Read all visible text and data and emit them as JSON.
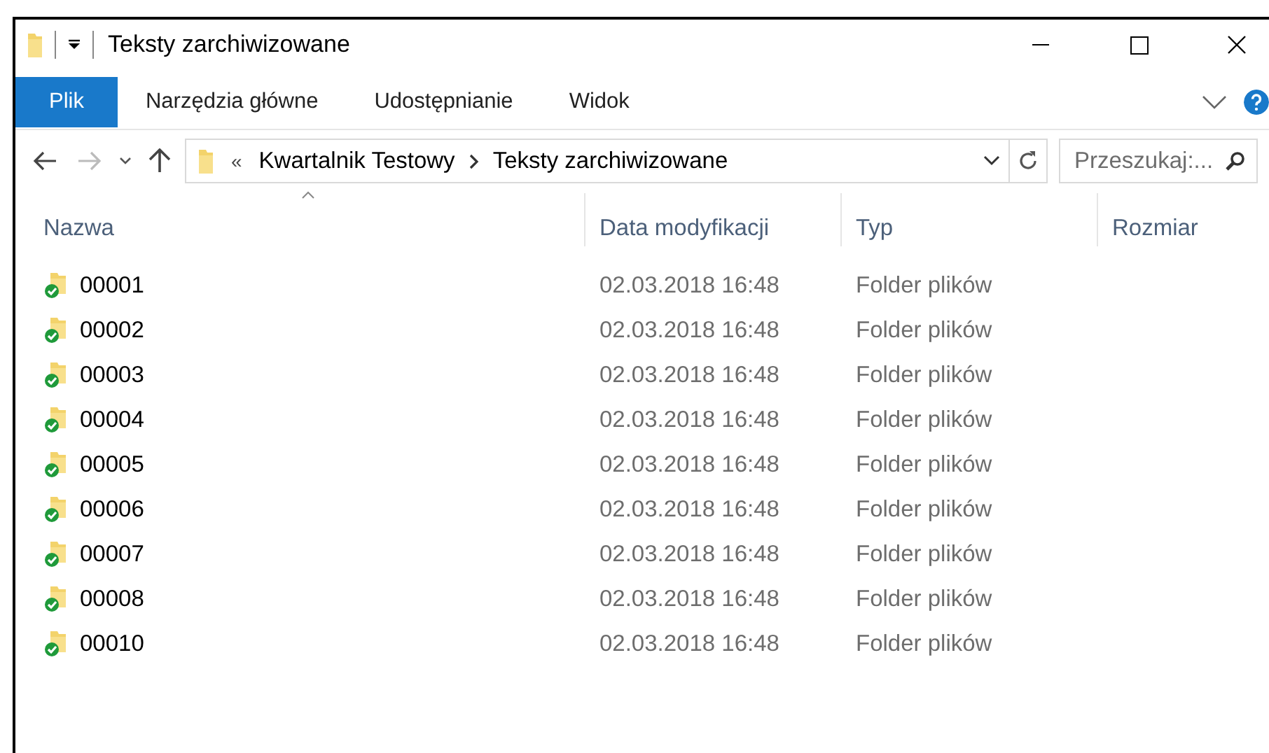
{
  "window": {
    "title": "Teksty zarchiwizowane"
  },
  "ribbon": {
    "tabs": [
      {
        "label": "Plik",
        "selected": true
      },
      {
        "label": "Narzędzia główne",
        "selected": false
      },
      {
        "label": "Udostępnianie",
        "selected": false
      },
      {
        "label": "Widok",
        "selected": false
      }
    ]
  },
  "address": {
    "overflow": "«",
    "path": [
      "Kwartalnik Testowy",
      "Teksty zarchiwizowane"
    ]
  },
  "search": {
    "placeholder": "Przeszukaj:..."
  },
  "columns": [
    {
      "label": "Nazwa",
      "sorted": true
    },
    {
      "label": "Data modyfikacji",
      "sorted": false
    },
    {
      "label": "Typ",
      "sorted": false
    },
    {
      "label": "Rozmiar",
      "sorted": false
    }
  ],
  "rows": [
    {
      "name": "00001",
      "date": "02.03.2018 16:48",
      "type": "Folder plików"
    },
    {
      "name": "00002",
      "date": "02.03.2018 16:48",
      "type": "Folder plików"
    },
    {
      "name": "00003",
      "date": "02.03.2018 16:48",
      "type": "Folder plików"
    },
    {
      "name": "00004",
      "date": "02.03.2018 16:48",
      "type": "Folder plików"
    },
    {
      "name": "00005",
      "date": "02.03.2018 16:48",
      "type": "Folder plików"
    },
    {
      "name": "00006",
      "date": "02.03.2018 16:48",
      "type": "Folder plików"
    },
    {
      "name": "00007",
      "date": "02.03.2018 16:48",
      "type": "Folder plików"
    },
    {
      "name": "00008",
      "date": "02.03.2018 16:48",
      "type": "Folder plików"
    },
    {
      "name": "00010",
      "date": "02.03.2018 16:48",
      "type": "Folder plików"
    }
  ]
}
